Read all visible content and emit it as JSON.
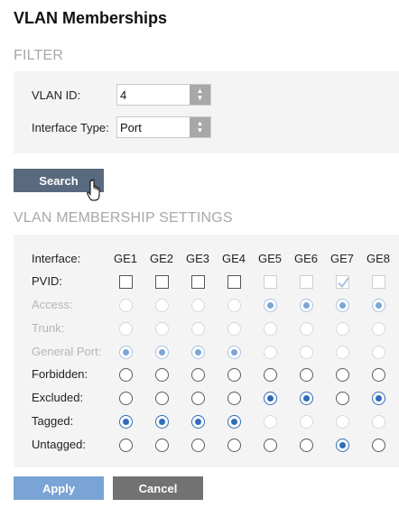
{
  "page_title": "VLAN Memberships",
  "filter": {
    "heading": "FILTER",
    "vlan_id_label": "VLAN ID:",
    "vlan_id_value": "4",
    "interface_type_label": "Interface Type:",
    "interface_type_value": "Port"
  },
  "search_button": "Search",
  "settings": {
    "heading": "VLAN MEMBERSHIP SETTINGS",
    "interface_label": "Interface:",
    "columns": [
      "GE1",
      "GE2",
      "GE3",
      "GE4",
      "GE5",
      "GE6",
      "GE7",
      "GE8"
    ],
    "rows": {
      "pvid": {
        "label": "PVID:",
        "type": "checkbox",
        "checked": [
          false,
          false,
          false,
          false,
          false,
          false,
          true,
          false
        ],
        "disabled": [
          false,
          false,
          false,
          false,
          true,
          true,
          true,
          true
        ]
      },
      "access": {
        "label": "Access:",
        "type": "radio",
        "label_disabled": true,
        "selected": [
          false,
          false,
          false,
          false,
          true,
          true,
          true,
          true
        ],
        "disabled": [
          true,
          true,
          true,
          true,
          true,
          true,
          true,
          true
        ]
      },
      "trunk": {
        "label": "Trunk:",
        "type": "radio",
        "label_disabled": true,
        "selected": [
          false,
          false,
          false,
          false,
          false,
          false,
          false,
          false
        ],
        "disabled": [
          true,
          true,
          true,
          true,
          true,
          true,
          true,
          true
        ]
      },
      "general_port": {
        "label": "General Port:",
        "type": "radio",
        "label_disabled": true,
        "selected": [
          true,
          true,
          true,
          true,
          false,
          false,
          false,
          false
        ],
        "disabled": [
          true,
          true,
          true,
          true,
          true,
          true,
          true,
          true
        ]
      },
      "forbidden": {
        "label": "Forbidden:",
        "type": "radio",
        "selected": [
          false,
          false,
          false,
          false,
          false,
          false,
          false,
          false
        ],
        "disabled": [
          false,
          false,
          false,
          false,
          false,
          false,
          false,
          false
        ]
      },
      "excluded": {
        "label": "Excluded:",
        "type": "radio",
        "selected": [
          false,
          false,
          false,
          false,
          true,
          true,
          false,
          true
        ],
        "disabled": [
          false,
          false,
          false,
          false,
          false,
          false,
          false,
          false
        ]
      },
      "tagged": {
        "label": "Tagged:",
        "type": "radio",
        "selected": [
          true,
          true,
          true,
          true,
          false,
          false,
          false,
          false
        ],
        "disabled": [
          false,
          false,
          false,
          false,
          true,
          true,
          true,
          true
        ]
      },
      "untagged": {
        "label": "Untagged:",
        "type": "radio",
        "selected": [
          false,
          false,
          false,
          false,
          false,
          false,
          true,
          false
        ],
        "disabled": [
          false,
          false,
          false,
          false,
          false,
          false,
          false,
          false
        ]
      }
    }
  },
  "apply_button": "Apply",
  "cancel_button": "Cancel",
  "colors": {
    "accent": "#2f6db8",
    "search_button": "#596a7f",
    "apply_button": "#7aa3d6",
    "cancel_button": "#727272"
  }
}
